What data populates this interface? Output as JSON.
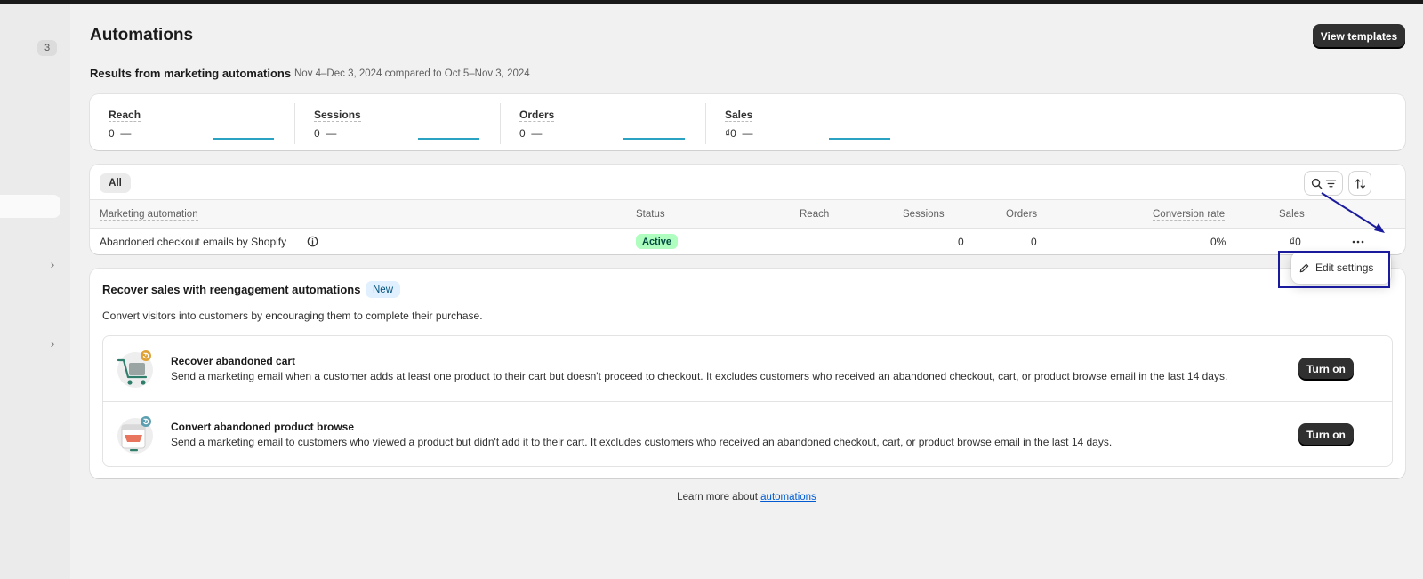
{
  "sidebar": {
    "badge_count": "3"
  },
  "page": {
    "title": "Automations",
    "view_templates_label": "View templates"
  },
  "results": {
    "title": "Results from marketing automations",
    "range": "Nov 4–Dec 3, 2024 compared to Oct 5–Nov 3, 2024",
    "metrics": [
      {
        "label": "Reach",
        "value": "0",
        "change": "—"
      },
      {
        "label": "Sessions",
        "value": "0",
        "change": "—"
      },
      {
        "label": "Orders",
        "value": "0",
        "change": "—"
      },
      {
        "label": "Sales",
        "value": "₫0",
        "change": "—"
      }
    ],
    "spark_color": "#2aa2c2"
  },
  "table": {
    "tab_all": "All",
    "columns": [
      "Marketing automation",
      "Status",
      "Reach",
      "Sessions",
      "Orders",
      "Conversion rate",
      "Sales"
    ],
    "rows": [
      {
        "name": "Abandoned checkout emails by Shopify",
        "status": "Active",
        "reach": "",
        "sessions": "0",
        "orders": "0",
        "conversion_rate": "0%",
        "sales": "₫0"
      }
    ],
    "icons": [
      "search-icon",
      "filter-icon",
      "sort-icon",
      "more-icon",
      "info-icon"
    ]
  },
  "popover": {
    "edit_settings_label": "Edit settings",
    "icon": "pencil-icon"
  },
  "recover": {
    "title": "Recover sales with reengagement automations",
    "badge": "New",
    "description": "Convert visitors into customers by encouraging them to complete their purchase.",
    "items": [
      {
        "name": "Recover abandoned cart",
        "description": "Send a marketing email when a customer adds at least one product to their cart but doesn't proceed to checkout. It excludes customers who received an abandoned checkout, cart, or product browse email in the last 14 days.",
        "button": "Turn on",
        "icon": "cart-illustration"
      },
      {
        "name": "Convert abandoned product browse",
        "description": "Send a marketing email to customers who viewed a product but didn't add it to their cart. It excludes customers who received an abandoned checkout, cart, or product browse email in the last 14 days.",
        "button": "Turn on",
        "icon": "browse-illustration"
      }
    ]
  },
  "footer": {
    "learn_more_prefix": "Learn more about ",
    "learn_more_link": "automations"
  },
  "colors": {
    "primary_button": "#303030",
    "active_badge_bg": "#affebf",
    "new_badge_bg": "#e0f0ff",
    "link": "#005bd3",
    "annotation": "#1a1a9c"
  }
}
